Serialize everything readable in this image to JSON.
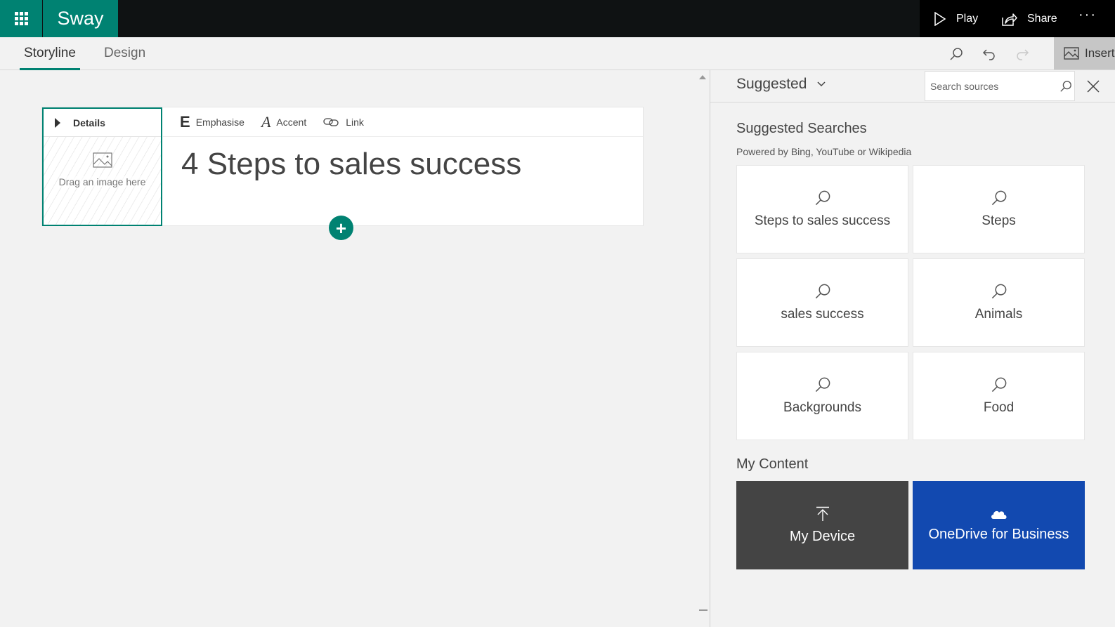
{
  "app": {
    "name": "Sway"
  },
  "topbar": {
    "play_label": "Play",
    "share_label": "Share",
    "more_label": "···"
  },
  "tabs": [
    {
      "label": "Storyline",
      "active": true
    },
    {
      "label": "Design",
      "active": false
    }
  ],
  "toolbar": {
    "insert_label": "Insert"
  },
  "card": {
    "details_label": "Details",
    "dropzone_text": "Drag an image here",
    "format": {
      "emphasise_label": "Emphasise",
      "emphasise_glyph": "E",
      "accent_label": "Accent",
      "accent_glyph": "A",
      "link_label": "Link"
    },
    "title": "4 Steps to sales success",
    "add_glyph": "+"
  },
  "panel": {
    "source_label": "Suggested",
    "search_placeholder": "Search sources",
    "suggested_heading": "Suggested Searches",
    "suggested_sub": "Powered by Bing, YouTube or Wikipedia",
    "suggestions": [
      {
        "label": "Steps to sales success"
      },
      {
        "label": "Steps"
      },
      {
        "label": "sales success"
      },
      {
        "label": "Animals"
      },
      {
        "label": "Backgrounds"
      },
      {
        "label": "Food"
      }
    ],
    "my_content_heading": "My Content",
    "my_content": [
      {
        "label": "My Device",
        "icon": "upload-icon",
        "color": "#444444"
      },
      {
        "label": "OneDrive for Business",
        "icon": "cloud-icon",
        "color": "#1249b0"
      }
    ]
  },
  "colors": {
    "accent": "#008272",
    "topbar": "#0f1213",
    "onedrive": "#1249b0",
    "device": "#444444"
  }
}
